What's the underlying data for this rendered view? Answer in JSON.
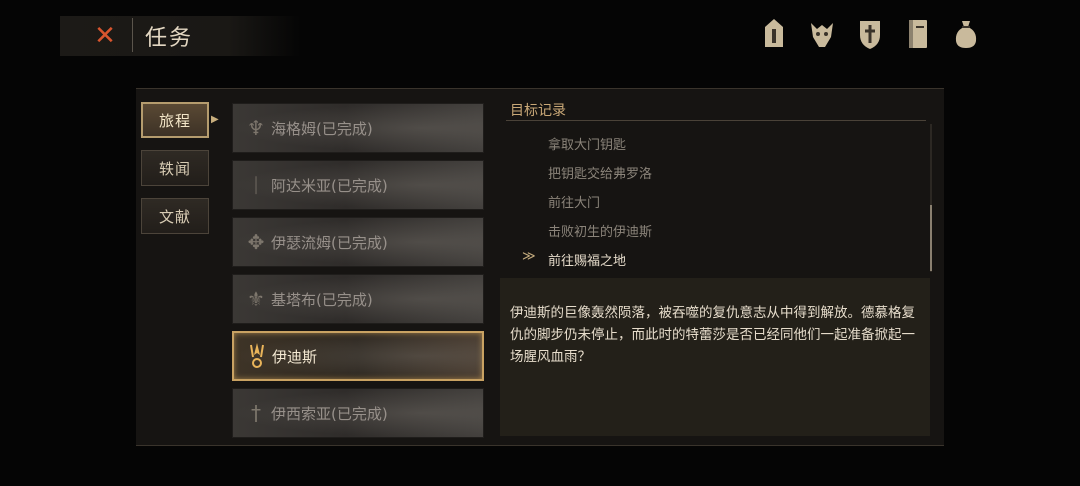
{
  "header": {
    "close_icon": "close-x-icon",
    "title": "任务"
  },
  "top_icons": [
    "helmet-icon",
    "beast-skull-icon",
    "shield-emblem-icon",
    "journal-icon",
    "pouch-icon"
  ],
  "categories": [
    {
      "label": "旅程",
      "active": true
    },
    {
      "label": "轶闻",
      "active": false
    },
    {
      "label": "文献",
      "active": false
    }
  ],
  "quests": [
    {
      "label": "海格姆(已完成)",
      "icon": "spire-icon",
      "active": false
    },
    {
      "label": "阿达米亚(已完成)",
      "icon": "blade-icon",
      "active": false
    },
    {
      "label": "伊瑟流姆(已完成)",
      "icon": "winged-axe-icon",
      "active": false
    },
    {
      "label": "基塔布(已完成)",
      "icon": "crest-icon",
      "active": false
    },
    {
      "label": "伊迪斯",
      "icon": "flame-ring-icon",
      "active": true
    },
    {
      "label": "伊西索亚(已完成)",
      "icon": "sword-emblem-icon",
      "active": false
    }
  ],
  "objectives": {
    "title": "目标记录",
    "items": [
      {
        "text": "拿取大门钥匙",
        "current": false
      },
      {
        "text": "把钥匙交给弗罗洛",
        "current": false
      },
      {
        "text": "前往大门",
        "current": false
      },
      {
        "text": "击败初生的伊迪斯",
        "current": false
      },
      {
        "text": "前往赐福之地",
        "current": true
      }
    ]
  },
  "description": "伊迪斯的巨像轰然陨落，被吞噬的复仇意志从中得到解放。德慕格复仇的脚步仍未停止，而此时的特蕾莎是否已经同他们一起准备掀起一场腥风血雨？",
  "colors": {
    "accent_gold": "#c9a262",
    "close_red": "#d8552e",
    "active_flame": "#e9b45a"
  }
}
